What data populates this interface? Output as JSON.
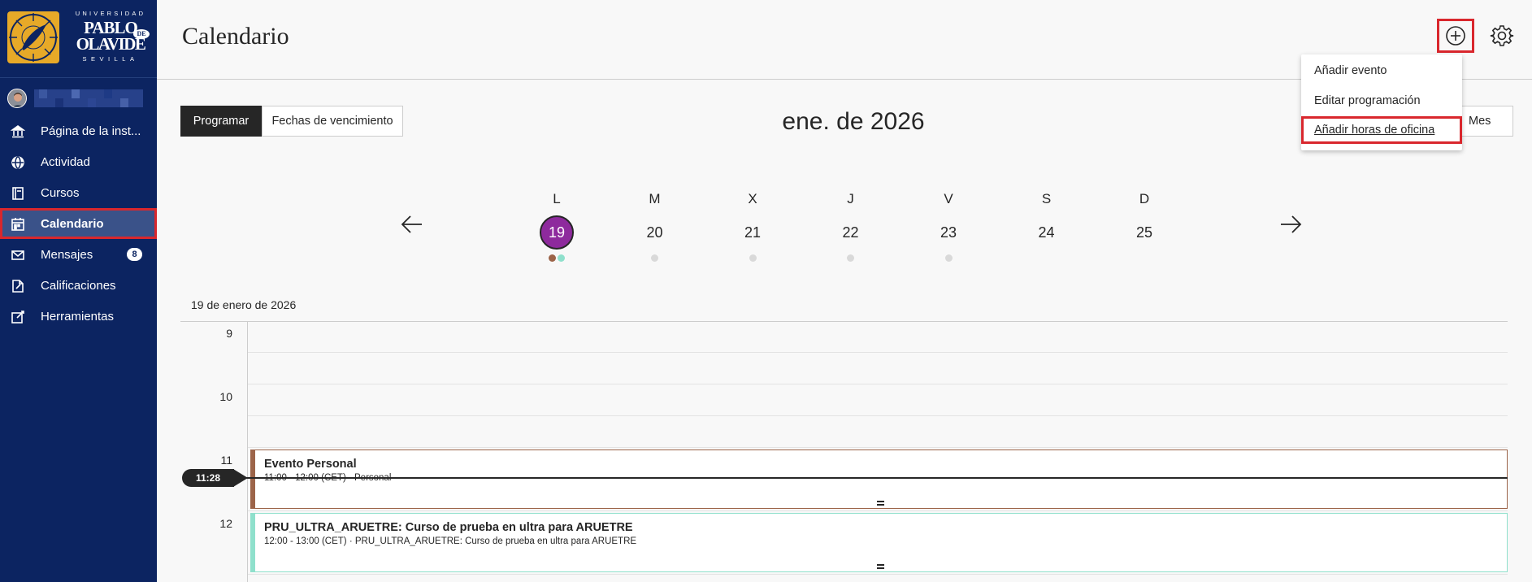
{
  "sidebar": {
    "logo": {
      "top_text": "UNIVERSIDAD",
      "name_line1": "PABLO",
      "name_line2": "OLAVIDE",
      "name_de": "DE",
      "bottom_text": "SEVILLA"
    },
    "items": [
      {
        "label": "Página de la inst...",
        "icon": "institution-icon"
      },
      {
        "label": "Actividad",
        "icon": "globe-icon"
      },
      {
        "label": "Cursos",
        "icon": "book-icon"
      },
      {
        "label": "Calendario",
        "icon": "calendar-icon"
      },
      {
        "label": "Mensajes",
        "icon": "envelope-icon",
        "badge": "8"
      },
      {
        "label": "Calificaciones",
        "icon": "grades-icon"
      },
      {
        "label": "Herramientas",
        "icon": "tools-icon"
      }
    ],
    "active_index": 3
  },
  "header": {
    "title": "Calendario"
  },
  "add_menu": {
    "items": [
      "Añadir evento",
      "Editar programación",
      "Añadir horas de oficina"
    ],
    "highlighted_index": 2
  },
  "toolbar": {
    "segments": [
      "Programar",
      "Fechas de vencimiento"
    ],
    "selected_segment": 0,
    "month_title": "ene. de 2026",
    "view_label": "Mes"
  },
  "week": {
    "days": [
      {
        "letter": "L",
        "num": "19",
        "selected": true,
        "dots": [
          "#9c6449",
          "#8fe0cc"
        ]
      },
      {
        "letter": "M",
        "num": "20",
        "dots": [
          "#d9d9d9"
        ]
      },
      {
        "letter": "X",
        "num": "21",
        "dots": [
          "#d9d9d9"
        ]
      },
      {
        "letter": "J",
        "num": "22",
        "dots": [
          "#d9d9d9"
        ]
      },
      {
        "letter": "V",
        "num": "23",
        "dots": [
          "#d9d9d9"
        ]
      },
      {
        "letter": "S",
        "num": "24",
        "dots": []
      },
      {
        "letter": "D",
        "num": "25",
        "dots": []
      }
    ]
  },
  "schedule": {
    "date_label": "19 de enero de 2026",
    "hours": [
      "9",
      "10",
      "11",
      "12"
    ],
    "now_label": "11:28",
    "events": [
      {
        "title": "Evento Personal",
        "subtitle": "11:00 - 12:00 (CET) · Personal",
        "color": "#9c6449"
      },
      {
        "title": "PRU_ULTRA_ARUETRE: Curso de prueba en ultra para ARUETRE",
        "subtitle": "12:00 - 13:00 (CET) · PRU_ULTRA_ARUETRE: Curso de prueba en ultra para ARUETRE",
        "color": "#8fe0cc"
      }
    ]
  },
  "colors": {
    "sidebar_bg": "#0c2461",
    "active_item_bg": "#3a5289",
    "highlight_border": "#d9272d",
    "selected_day": "#8e2a9d"
  }
}
